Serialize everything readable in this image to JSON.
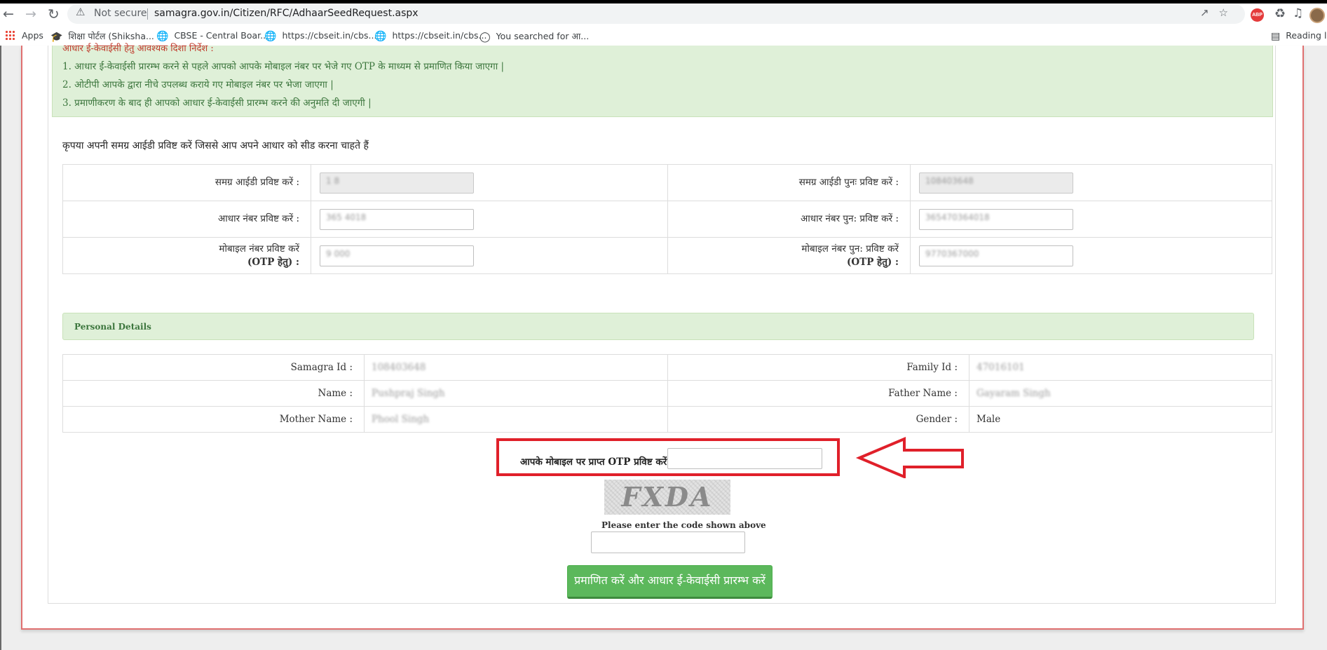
{
  "browser": {
    "not_secure_label": "Not secure",
    "url": "samagra.gov.in/Citizen/RFC/AdhaarSeedRequest.aspx",
    "bookmarks": [
      {
        "label": "Apps",
        "icon": "apps-grid-icon"
      },
      {
        "label": "शिक्षा पोर्टल (Shiksha...",
        "icon": "graduation-cap-icon"
      },
      {
        "label": "CBSE - Central Boar...",
        "icon": "globe-icon"
      },
      {
        "label": "https://cbseit.in/cbs...",
        "icon": "globe-icon"
      },
      {
        "label": "https://cbseit.in/cbs...",
        "icon": "globe-icon"
      },
      {
        "label": "You searched for आ...",
        "icon": "site-logo-icon"
      }
    ],
    "reading_list_label": "Reading l",
    "extension_abp_label": "ABP"
  },
  "notice": {
    "heading": "आधार ई-केवाईसी हेतु आवश्यक दिशा निर्देश :",
    "lines": [
      "1. आधार ई-केवाईसी प्रारम्भ करने से पहले आपको आपके मोबाइल नंबर पर भेजे गए OTP के माध्यम से प्रमाणित किया जाएगा |",
      "2. ओटीपी आपके द्वारा नीचे उपलब्ध कराये गए मोबाइल नंबर पर भेजा जाएगा |",
      "3. प्रमाणीकरण के बाद ही आपको आधार ई-केवाईसी प्रारम्भ करने की अनुमति दी जाएगी |"
    ]
  },
  "samagra_prompt": "कृपया अपनी समग्र आईडी प्रविष्ट करें जिससे आप अपने आधार को सीड करना चाहते हैं",
  "id_form": {
    "samagra_id_label": "समग्र आईडी प्रविष्ट करें :",
    "samagra_id_value": "1      8",
    "samagra_id_confirm_label": "समग्र आईडी पुनः प्रविष्ट करें :",
    "samagra_id_confirm_value": "108403648",
    "aadhaar_label": "आधार नंबर प्रविष्ट करें :",
    "aadhaar_value": "365      4018",
    "aadhaar_confirm_label": "आधार नंबर पुन: प्रविष्ट करें :",
    "aadhaar_confirm_value": "365470364018",
    "mobile_label_line1": "मोबाइल नंबर प्रविष्ट करें",
    "mobile_label_line2": "(OTP हेतु) :",
    "mobile_value": "9       000",
    "mobile_confirm_label_line1": "मोबाइल नंबर पुन: प्रविष्ट करें",
    "mobile_confirm_label_line2": "(OTP हेतु) :",
    "mobile_confirm_value": "9770367000"
  },
  "personal_details": {
    "header": "Personal Details",
    "samagra_id_label": "Samagra Id :",
    "samagra_id_value": "108403648",
    "family_id_label": "Family Id :",
    "family_id_value": "47016101",
    "name_label": "Name :",
    "name_value": "Pushpraj Singh",
    "father_name_label": "Father Name :",
    "father_name_value": "Gayaram Singh",
    "mother_name_label": "Mother Name :",
    "mother_name_value": "Phool     Singh",
    "gender_label": "Gender :",
    "gender_value": "Male"
  },
  "otp": {
    "label": "आपके मोबाइल पर प्राप्त OTP प्रविष्ट करें :",
    "value": ""
  },
  "captcha": {
    "image_text": "FXDA",
    "hint": "Please enter the code shown above",
    "value": ""
  },
  "submit_label": "प्रमाणित करें और आधार ई-केवाईसी प्रारम्भ करें",
  "colors": {
    "notice_bg": "#dff0d8",
    "notice_text": "#3c763d",
    "highlight_red": "#e0202a",
    "button_green": "#5cb85c"
  }
}
